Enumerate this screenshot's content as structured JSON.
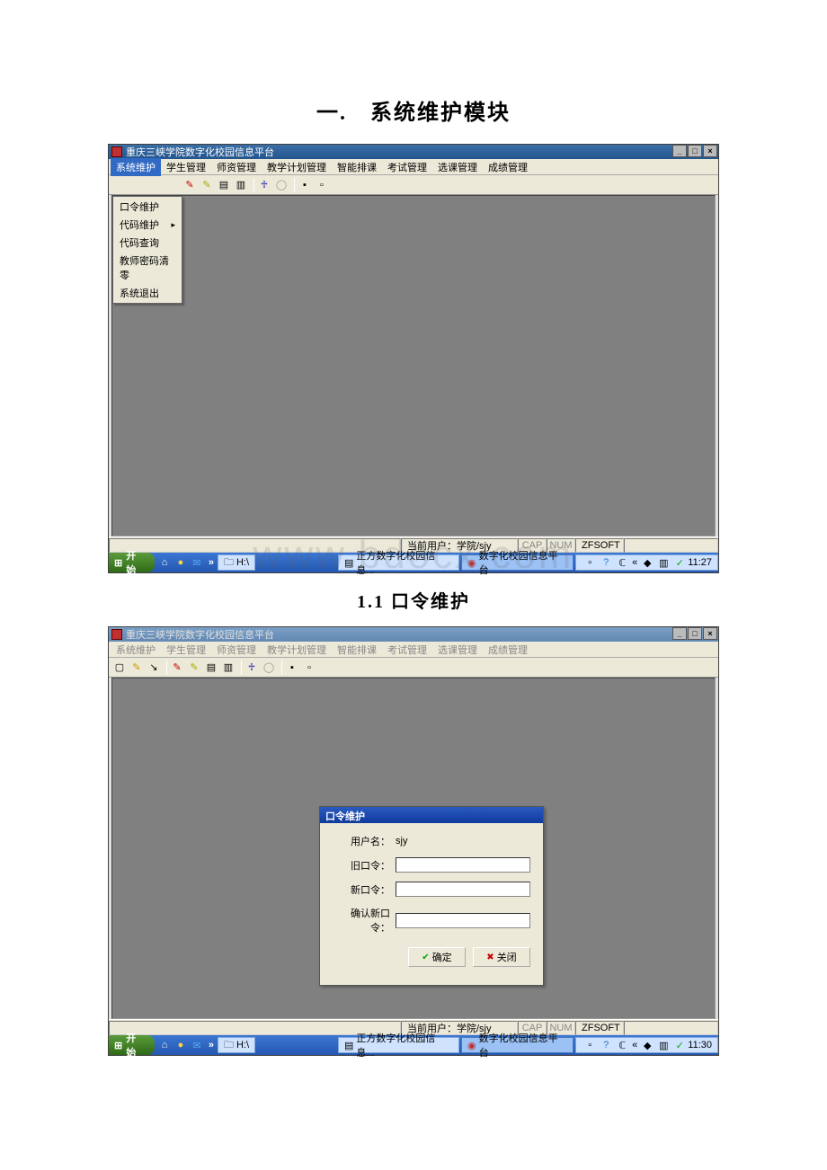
{
  "doc": {
    "heading1": "一.　系统维护模块",
    "heading2": "1.1 口令维护"
  },
  "watermark": "www.bdocx.com",
  "app": {
    "title": "重庆三峡学院数字化校园信息平台",
    "menus": [
      "系统维护",
      "学生管理",
      "师资管理",
      "教学计划管理",
      "智能排课",
      "考试管理",
      "选课管理",
      "成绩管理"
    ],
    "dropdown": [
      "口令维护",
      "代码维护",
      "代码查询",
      "教师密码清零",
      "系统退出"
    ],
    "status_user": "当前用户：学院/sjy",
    "status_cap": "CAP",
    "status_num": "NUM",
    "status_zf": "ZFSOFT"
  },
  "win": {
    "minimize": "_",
    "maximize": "□",
    "close": "×"
  },
  "taskbar": {
    "start": "开始",
    "drive": "H:\\",
    "app1": "正方数字化校园信息...",
    "app2": "数字化校园信息平台",
    "time1": "11:27",
    "time2": "11:30"
  },
  "dialog": {
    "title": "口令维护",
    "user_label": "用户名：",
    "user_value": "sjy",
    "old_label": "旧口令：",
    "new_label": "新口令：",
    "confirm_label": "确认新口令：",
    "ok": "确定",
    "close": "关闭"
  }
}
